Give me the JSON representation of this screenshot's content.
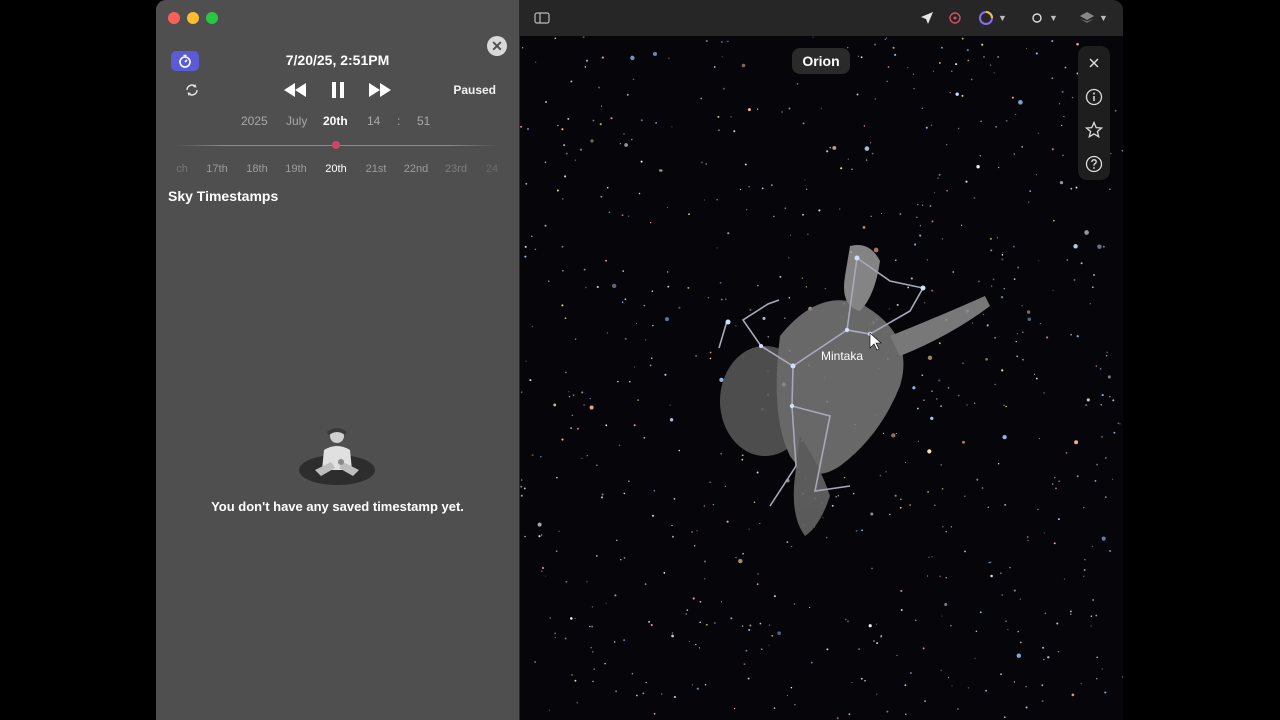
{
  "left_panel": {
    "datetime": "7/20/25, 2:51PM",
    "status": "Paused",
    "date_picker": {
      "year": "2025",
      "month": "July",
      "day": "20th",
      "hour": "14",
      "separator": ":",
      "minute": "51"
    },
    "day_strip": [
      "ch",
      "17th",
      "18th",
      "19th",
      "20th",
      "21st",
      "22nd",
      "23rd",
      "24"
    ],
    "section_title": "Sky Timestamps",
    "empty_message": "You don't have any saved timestamp yet."
  },
  "sky": {
    "constellation_label": "Orion",
    "star_label": "Mintaka"
  },
  "icons": {
    "app": "stopwatch-icon",
    "sync": "sync-icon",
    "close": "close-icon",
    "sidebar": "sidebar-toggle-icon",
    "location": "location-arrow-icon",
    "info": "info-icon",
    "favorite": "star-icon",
    "help": "help-icon"
  },
  "colors": {
    "accent": "#5b5bd6",
    "slider_thumb": "#d0456b",
    "panel_bg": "#4f4f4f"
  }
}
